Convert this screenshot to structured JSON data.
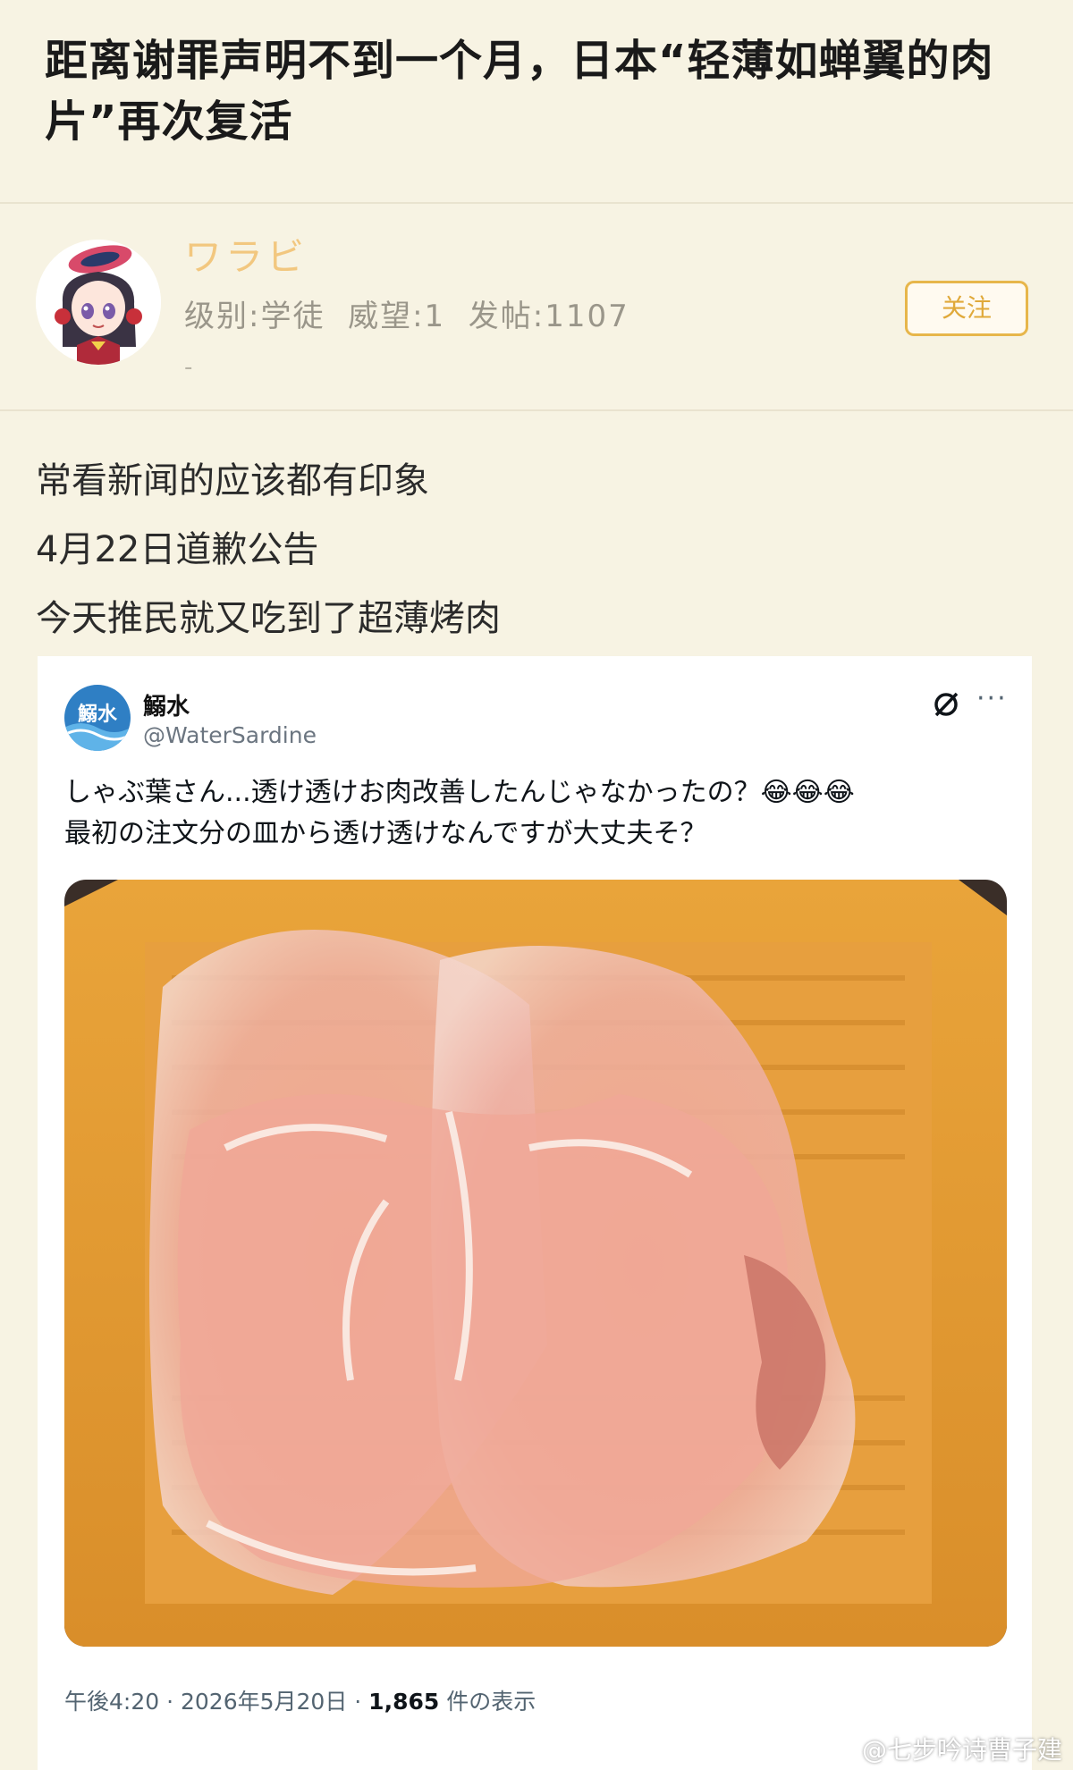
{
  "post": {
    "title": "距离谢罪声明不到一个月，日本“轻薄如蝉翼的肉片”再次复活"
  },
  "author": {
    "name": "ワラビ",
    "meta": "级别:学徒  威望:1  发帖:1107",
    "extra": "-",
    "follow_label": "关注",
    "accent_color": "#e7b64b"
  },
  "body": {
    "lines": [
      "常看新闻的应该都有印象",
      "4月22日道歉公告",
      "今天推民就又吃到了超薄烤肉"
    ]
  },
  "tweet": {
    "display_name": "鰯水",
    "avatar_text": "鰯水",
    "handle": "@WaterSardine",
    "more_label": "···",
    "text_line1": "しゃぶ葉さん...透け透けお肉改善したんじゃなかったの？😂😂😂",
    "text_line2": "最初の注文分の皿から透け透けなんですが大丈夫そ？",
    "time": "午後4:20 · 2026年5月20日 · ",
    "views": "1,865",
    "views_label": " 件の表示"
  },
  "watermark": "@七步吟诗曹子建"
}
